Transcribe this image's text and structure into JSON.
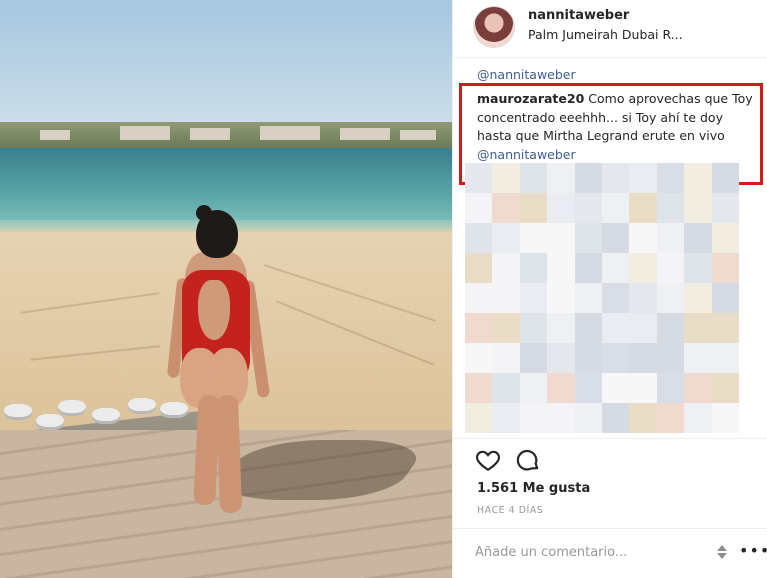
{
  "post": {
    "username": "nannitaweber",
    "location": "Palm Jumeirah Dubai R...",
    "mention_top": "@nannitaweber",
    "highlighted_comment": {
      "username": "maurozarate20",
      "text": "Como aprovechas que Toy concentrado eeehhh... si Toy ahí te doy hasta que Mirtha Legrand erute en vivo",
      "mention": "@nannitaweber",
      "highlight_color": "#d21c1c"
    },
    "likes": "1.561 Me gusta",
    "time_ago": "HACE 4 DÍAS",
    "add_comment_placeholder": "Añade un comentario...",
    "icons": {
      "like": "heart-icon",
      "comment": "comment-icon",
      "stepper": "stepper-icon",
      "more": "more-options-icon"
    }
  },
  "colors": {
    "link": "#3f5f95",
    "text": "#262626",
    "muted": "#999999"
  }
}
